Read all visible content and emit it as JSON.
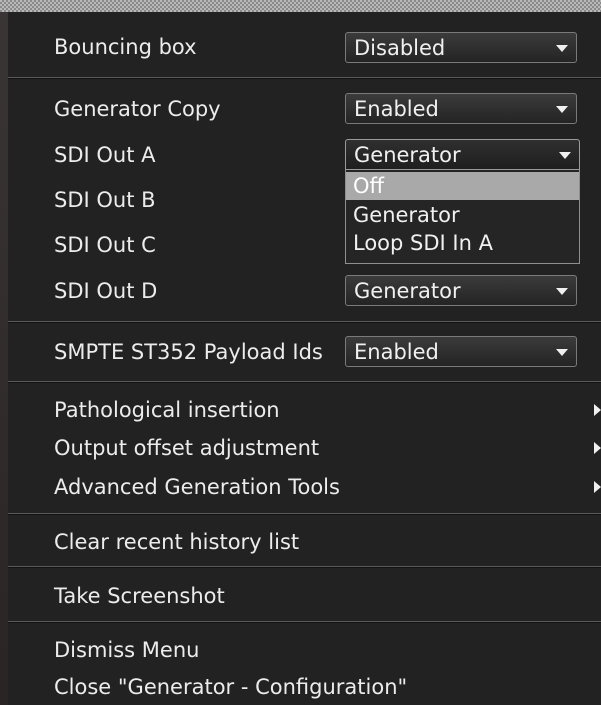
{
  "menu": {
    "bouncing_box": {
      "label": "Bouncing box",
      "value": "Disabled"
    },
    "generator_copy": {
      "label": "Generator Copy",
      "value": "Enabled"
    },
    "sdi_out_a": {
      "label": "SDI Out A",
      "value": "Generator"
    },
    "sdi_out_a_options": [
      "Off",
      "Generator",
      "Loop SDI In A"
    ],
    "sdi_out_a_highlighted": "Off",
    "sdi_out_b": {
      "label": "SDI Out B"
    },
    "sdi_out_c": {
      "label": "SDI Out C"
    },
    "sdi_out_d": {
      "label": "SDI Out D",
      "value": "Generator"
    },
    "smpte_payload": {
      "label": "SMPTE ST352 Payload Ids",
      "value": "Enabled"
    },
    "submenus": [
      {
        "label": "Pathological insertion"
      },
      {
        "label": "Output offset adjustment"
      },
      {
        "label": "Advanced Generation Tools"
      }
    ],
    "actions": {
      "clear_history": "Clear recent history list",
      "take_screenshot": "Take Screenshot",
      "dismiss": "Dismiss Menu",
      "close": "Close \"Generator - Configuration\""
    }
  },
  "colors": {
    "menu_background": "#222222",
    "highlight": "#a9a9a9",
    "separator": "#5a5a5a",
    "text": "#ececec"
  },
  "icons": {
    "combo_arrow": "chevron-down-icon",
    "submenu_arrow": "chevron-right-icon"
  }
}
